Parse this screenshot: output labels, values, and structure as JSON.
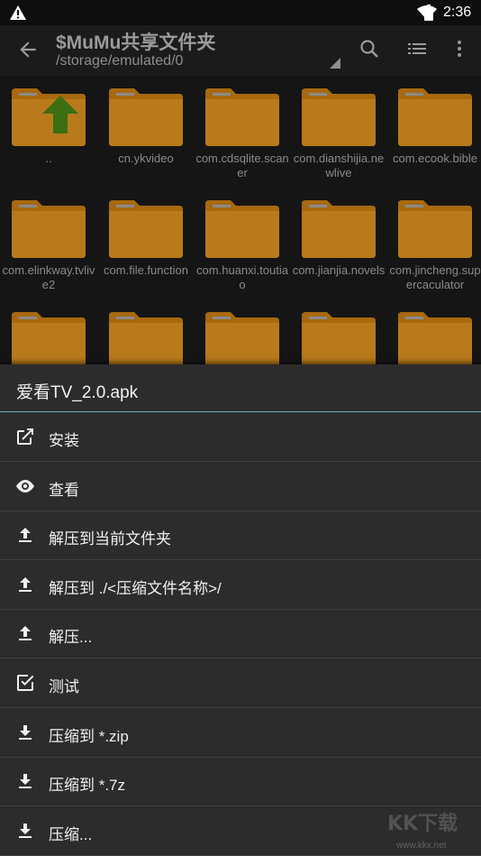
{
  "status": {
    "time": "2:36"
  },
  "toolbar": {
    "title": "$MuMu共享文件夹",
    "path": "/storage/emulated/0"
  },
  "files": [
    {
      "name": "..",
      "type": "up"
    },
    {
      "name": "cn.ykvideo",
      "type": "folder"
    },
    {
      "name": "com.cdsqlite.scaner",
      "type": "folder"
    },
    {
      "name": "com.dianshijia.newlive",
      "type": "folder"
    },
    {
      "name": "com.ecook.bible",
      "type": "folder"
    },
    {
      "name": "com.elinkway.tvlive2",
      "type": "folder"
    },
    {
      "name": "com.file.function",
      "type": "folder"
    },
    {
      "name": "com.huanxi.toutiao",
      "type": "folder"
    },
    {
      "name": "com.jianjia.novels",
      "type": "folder"
    },
    {
      "name": "com.jincheng.supercaculator",
      "type": "folder"
    },
    {
      "name": "",
      "type": "folder"
    },
    {
      "name": "",
      "type": "folder"
    },
    {
      "name": "",
      "type": "folder"
    },
    {
      "name": "",
      "type": "folder"
    },
    {
      "name": "",
      "type": "folder"
    }
  ],
  "sheet": {
    "title": "爱看TV_2.0.apk",
    "items": [
      {
        "label": "安装",
        "icon": "open-external-icon"
      },
      {
        "label": "查看",
        "icon": "eye-icon"
      },
      {
        "label": "解压到当前文件夹",
        "icon": "upload-icon"
      },
      {
        "label": "解压到 ./<压缩文件名称>/",
        "icon": "upload-icon"
      },
      {
        "label": "解压...",
        "icon": "upload-icon"
      },
      {
        "label": "测试",
        "icon": "checkbox-icon"
      },
      {
        "label": "压缩到 *.zip",
        "icon": "download-icon"
      },
      {
        "label": "压缩到 *.7z",
        "icon": "download-icon"
      },
      {
        "label": "压缩...",
        "icon": "download-icon"
      }
    ]
  },
  "watermark": {
    "text": "KK下载",
    "url": "www.kkx.net"
  }
}
